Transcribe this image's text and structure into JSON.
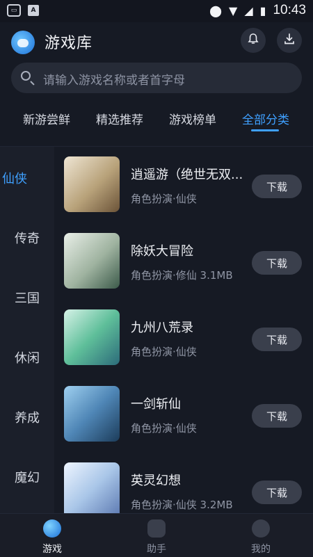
{
  "status_bar": {
    "left_icons": [
      "game-controller-icon",
      "a-notification-icon"
    ],
    "right_icons": [
      "location-icon",
      "wifi-icon",
      "signal-icon",
      "battery-icon"
    ],
    "a_glyph": "A",
    "time": "10:43"
  },
  "header": {
    "title": "游戏库",
    "bell_icon": "bell-icon",
    "download_icon": "download-icon"
  },
  "search": {
    "placeholder": "请输入游戏名称或者首字母"
  },
  "tabs": [
    {
      "label": "新游尝鲜"
    },
    {
      "label": "精选推荐"
    },
    {
      "label": "游戏榜单"
    },
    {
      "label": "全部分类"
    }
  ],
  "active_tab": "全部分类",
  "categories": [
    {
      "label": "仙侠"
    },
    {
      "label": "传奇"
    },
    {
      "label": "三国"
    },
    {
      "label": "休闲"
    },
    {
      "label": "养成"
    },
    {
      "label": "魔幻"
    }
  ],
  "active_category": "仙侠",
  "games": [
    {
      "name": "逍遥游（绝世无双...",
      "meta": "角色扮演·仙侠",
      "button": "下载",
      "thumb_color": "#c8b18a"
    },
    {
      "name": "除妖大冒险",
      "meta": "角色扮演·修仙   3.1MB",
      "button": "下载",
      "thumb_color": "#b9c7b5"
    },
    {
      "name": "九州八荒录",
      "meta": "角色扮演·仙侠",
      "button": "下载",
      "thumb_color": "#5fbf9a"
    },
    {
      "name": "一剑斩仙",
      "meta": "角色扮演·仙侠",
      "button": "下载",
      "thumb_color": "#4f86b6"
    },
    {
      "name": "英灵幻想",
      "meta": "角色扮演·仙侠   3.2MB",
      "button": "下载",
      "thumb_color": "#a9c6e8"
    }
  ],
  "bottom_nav": [
    {
      "label": "游戏",
      "icon": "planet-icon",
      "active": true
    },
    {
      "label": "助手",
      "icon": "gamepad-icon",
      "active": false
    },
    {
      "label": "我的",
      "icon": "user-icon",
      "active": false
    }
  ],
  "colors": {
    "accent": "#3fa0ff",
    "background": "#161a24"
  }
}
